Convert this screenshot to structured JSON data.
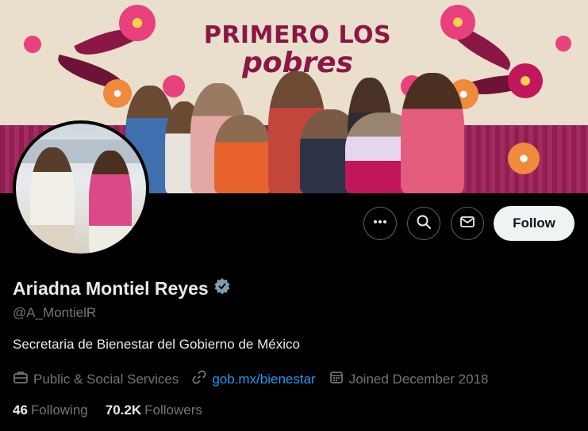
{
  "banner": {
    "title_line1": "PRIMERO LOS",
    "title_line2": "pobres",
    "accent_color": "#8a1746"
  },
  "profile": {
    "name": "Ariadna Montiel Reyes",
    "verified_icon": "verified-badge-icon",
    "handle": "@A_MontielR",
    "bio": "Secretaria de Bienestar del Gobierno de México",
    "category": "Public & Social Services",
    "link": "gob.mx/bienestar",
    "joined": "Joined December 2018",
    "following_count": "46",
    "following_label": "Following",
    "followers_count": "70.2K",
    "followers_label": "Followers"
  },
  "actions": {
    "more_icon": "more-icon",
    "search_icon": "search-icon",
    "message_icon": "message-icon",
    "follow_label": "Follow"
  },
  "colors": {
    "background": "#000000",
    "link": "#1d9bf0",
    "muted": "#71767b",
    "follow_bg": "#eff3f4"
  }
}
